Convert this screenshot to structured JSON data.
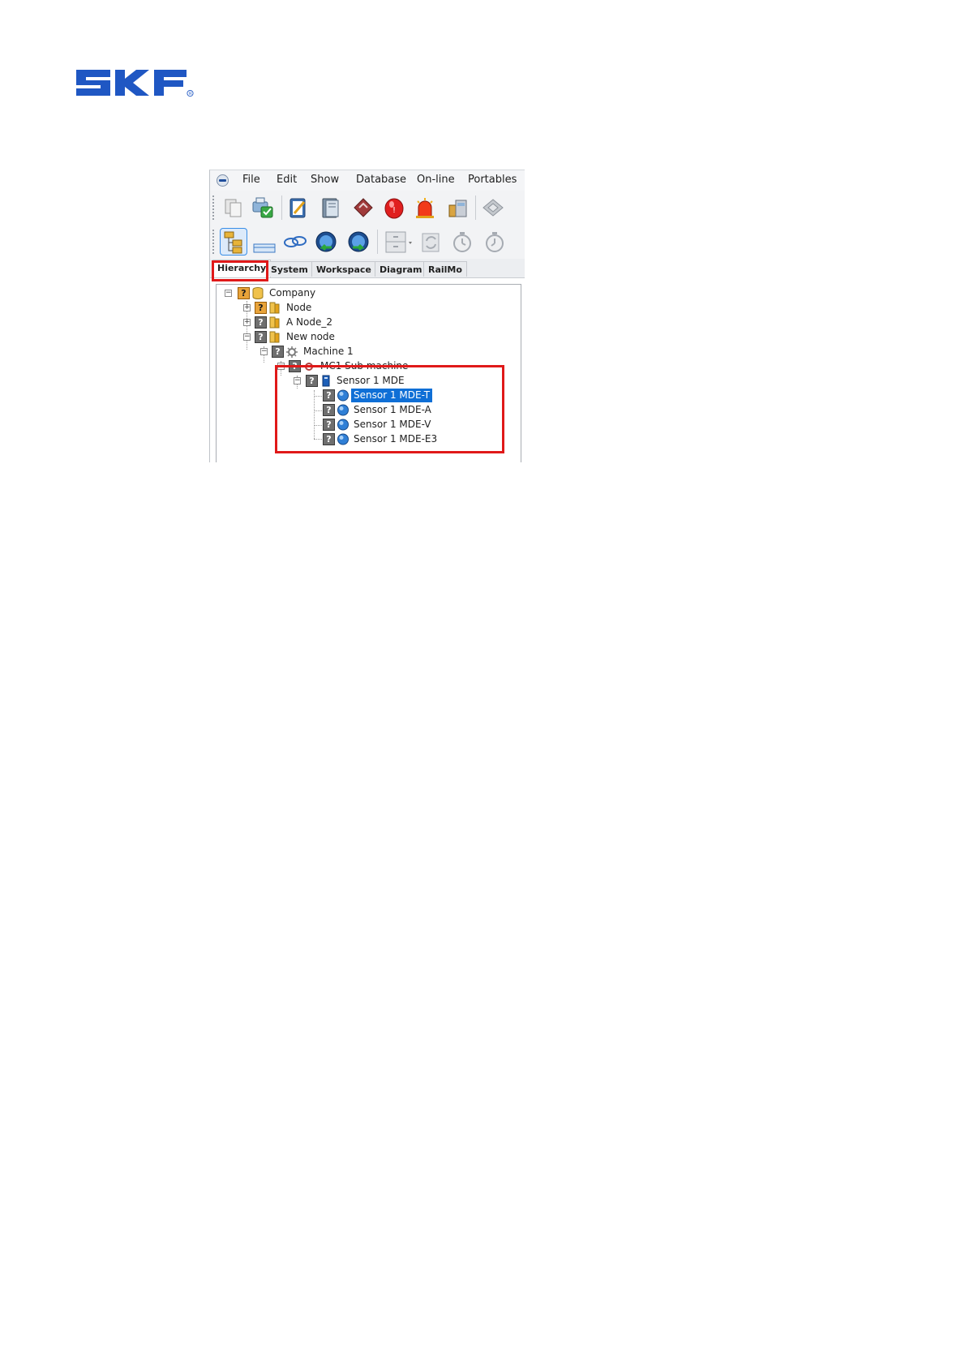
{
  "logo": {
    "text": "SKF",
    "color": "#1f57c3"
  },
  "menu": [
    "File",
    "Edit",
    "Show",
    "Database",
    "On-line",
    "Portables"
  ],
  "toolbar1_icons": [
    "copy-icon",
    "save-check-icon",
    "notepad-icon",
    "book-icon",
    "paperclip-icon",
    "red-alarm-icon",
    "siren-icon",
    "package-icon",
    "diamond-icon"
  ],
  "toolbar2_icons": [
    "hierarchy-icon",
    "panel-icon",
    "link-icon",
    "back-arrow-icon",
    "forward-arrow-icon",
    "cabinet-icon",
    "refresh-icon",
    "stopwatch-icon",
    "stopwatch-icon-2"
  ],
  "tabs": [
    "Hierarchy",
    "System",
    "Workspace",
    "Diagram",
    "RailMo"
  ],
  "tree": [
    {
      "label": "Company",
      "status": "?",
      "selected": false
    },
    {
      "label": "Node",
      "status": "?",
      "selected": false
    },
    {
      "label": "A Node_2",
      "status": "?",
      "selected": false
    },
    {
      "label": "New node",
      "status": "?",
      "selected": false
    },
    {
      "label": "Machine 1",
      "status": "?",
      "selected": false
    },
    {
      "label": "MC1 Sub machine",
      "status": "?",
      "selected": false
    },
    {
      "label": "Sensor 1 MDE",
      "status": "?",
      "selected": false
    },
    {
      "label": "Sensor 1 MDE-T",
      "status": "?",
      "selected": true
    },
    {
      "label": "Sensor 1 MDE-A",
      "status": "?",
      "selected": false
    },
    {
      "label": "Sensor 1 MDE-V",
      "status": "?",
      "selected": false
    },
    {
      "label": "Sensor 1 MDE-E3",
      "status": "?",
      "selected": false
    }
  ],
  "colors": {
    "highlight": "#e01919",
    "selection": "#0f6fd6",
    "status_unknown": "#6f6f6f",
    "status_warning": "#e8a33a"
  }
}
